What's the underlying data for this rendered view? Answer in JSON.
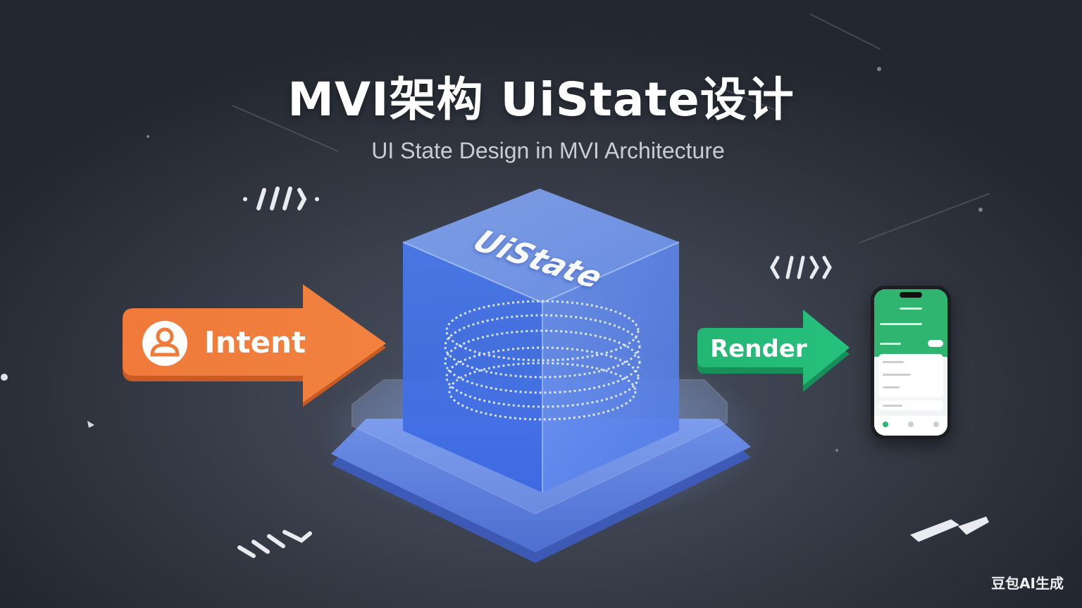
{
  "title": "MVI架构 UiState设计",
  "subtitle": "UI State Design in MVI Architecture",
  "nodes": {
    "intent": {
      "label": "Intent",
      "color": "#f07a38",
      "icon": "user-icon"
    },
    "uistate": {
      "label": "UiState",
      "color": "#3b6fe8"
    },
    "render": {
      "label": "Render",
      "color": "#22b978"
    },
    "device": {
      "icon": "smartphone-icon",
      "accent": "#2fb56f"
    }
  },
  "watermark": "豆包AI生成"
}
